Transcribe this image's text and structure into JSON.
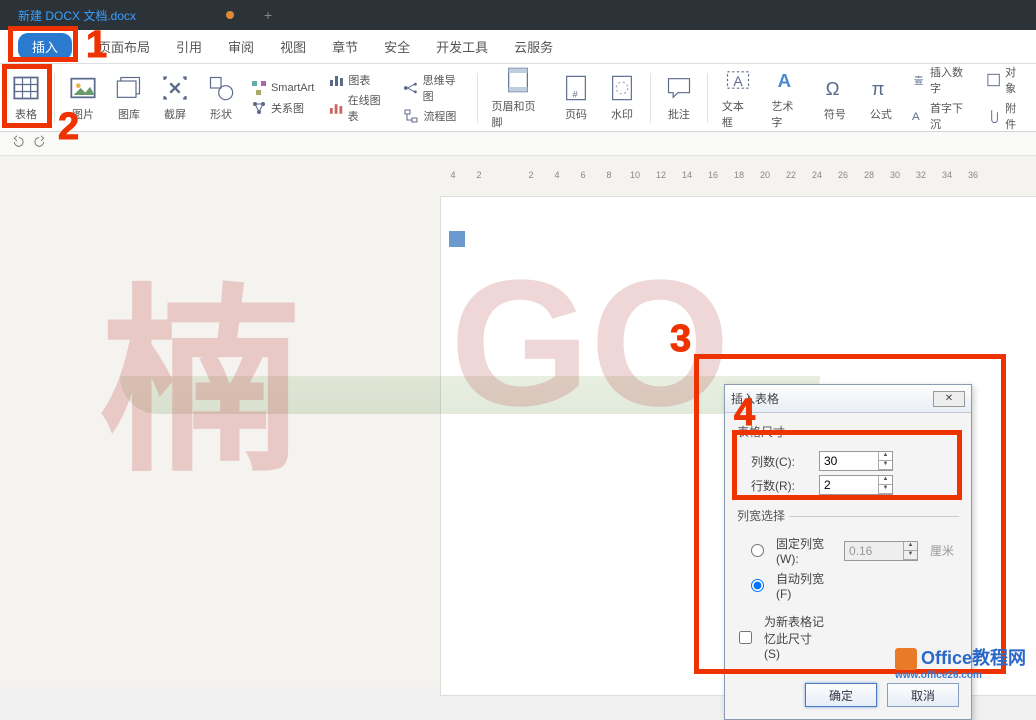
{
  "titlebar": {
    "tab_name": "新建 DOCX 文档.docx"
  },
  "menubar": {
    "active": "插入",
    "items": [
      "页面布局",
      "引用",
      "审阅",
      "视图",
      "章节",
      "安全",
      "开发工具",
      "云服务"
    ]
  },
  "ribbon": {
    "table": "表格",
    "picture": "图片",
    "gallery": "图库",
    "screenshot": "截屏",
    "shapes": "形状",
    "smartart": "SmartArt",
    "chart": "图表",
    "mindmap": "思维导图",
    "cross_ref": "关系图",
    "online_chart": "在线图表",
    "flowchart": "流程图",
    "header_footer": "页眉和页脚",
    "page_number": "页码",
    "watermark": "水印",
    "comment": "批注",
    "textbox": "文本框",
    "wordart": "艺术字",
    "symbol": "符号",
    "equation": "公式",
    "insert_number": "插入数字",
    "object": "对象",
    "drop_cap": "首字下沉",
    "attachment": "附件"
  },
  "ruler": [
    "4",
    "2",
    "",
    "2",
    "4",
    "6",
    "8",
    "10",
    "12",
    "14",
    "16",
    "18",
    "20",
    "22",
    "24",
    "26",
    "28",
    "30",
    "32",
    "34",
    "36"
  ],
  "dialog": {
    "title": "插入表格",
    "section_size": "表格尺寸",
    "cols_label": "列数(C):",
    "cols_value": "30",
    "rows_label": "行数(R):",
    "rows_value": "2",
    "section_width": "列宽选择",
    "fixed_width_label": "固定列宽(W):",
    "fixed_width_value": "0.16",
    "fixed_width_unit": "厘米",
    "auto_width_label": "自动列宽(F)",
    "remember_label": "为新表格记忆此尺寸(S)",
    "ok": "确定",
    "cancel": "取消"
  },
  "annotations": {
    "n1": "1",
    "n2": "2",
    "n3": "3",
    "n4": "4"
  },
  "footer": {
    "brand": "Office教程网",
    "url": "www.office26.com"
  }
}
